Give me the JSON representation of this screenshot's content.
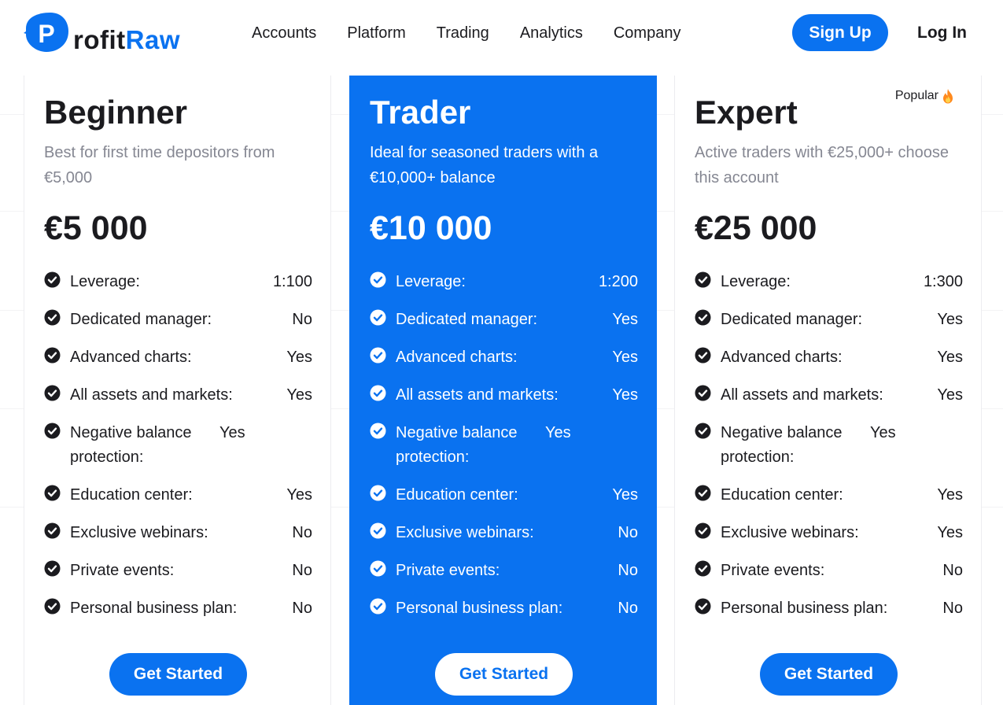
{
  "brand": {
    "logo_letter": "P",
    "name_dark": "rofit",
    "name_blue": "Raw",
    "accent": "#0a72f0"
  },
  "nav": {
    "items": [
      "Accounts",
      "Platform",
      "Trading",
      "Analytics",
      "Company"
    ],
    "signup_label": "Sign Up",
    "login_label": "Log In"
  },
  "plans": [
    {
      "name": "Beginner",
      "description": "Best for first time depositors from €5,000",
      "price": "€5 000",
      "badge": "",
      "cta_label": "Get Started",
      "features": [
        {
          "label": "Leverage:",
          "value": "1:100"
        },
        {
          "label": "Dedicated manager:",
          "value": "No"
        },
        {
          "label": "Advanced charts:",
          "value": "Yes"
        },
        {
          "label": "All assets and markets:",
          "value": "Yes"
        },
        {
          "label": "Negative balance protection:",
          "value": "Yes"
        },
        {
          "label": "Education center:",
          "value": "Yes"
        },
        {
          "label": "Exclusive webinars:",
          "value": "No"
        },
        {
          "label": "Private events:",
          "value": "No"
        },
        {
          "label": "Personal business plan:",
          "value": "No"
        }
      ]
    },
    {
      "name": "Trader",
      "description": "Ideal for seasoned traders with a €10,000+ balance",
      "price": "€10 000",
      "badge": "",
      "cta_label": "Get Started",
      "features": [
        {
          "label": "Leverage:",
          "value": "1:200"
        },
        {
          "label": "Dedicated manager:",
          "value": "Yes"
        },
        {
          "label": "Advanced charts:",
          "value": "Yes"
        },
        {
          "label": "All assets and markets:",
          "value": "Yes"
        },
        {
          "label": "Negative balance protection:",
          "value": "Yes"
        },
        {
          "label": "Education center:",
          "value": "Yes"
        },
        {
          "label": "Exclusive webinars:",
          "value": "No"
        },
        {
          "label": "Private events:",
          "value": "No"
        },
        {
          "label": "Personal business plan:",
          "value": "No"
        }
      ]
    },
    {
      "name": "Expert",
      "description": "Active traders with €25,000+ choose this account",
      "price": "€25 000",
      "badge": "Popular",
      "cta_label": "Get Started",
      "features": [
        {
          "label": "Leverage:",
          "value": "1:300"
        },
        {
          "label": "Dedicated manager:",
          "value": "Yes"
        },
        {
          "label": "Advanced charts:",
          "value": "Yes"
        },
        {
          "label": "All assets and markets:",
          "value": "Yes"
        },
        {
          "label": "Negative balance protection:",
          "value": "Yes"
        },
        {
          "label": "Education center:",
          "value": "Yes"
        },
        {
          "label": "Exclusive webinars:",
          "value": "Yes"
        },
        {
          "label": "Private events:",
          "value": "No"
        },
        {
          "label": "Personal business plan:",
          "value": "No"
        }
      ]
    }
  ],
  "icons": {
    "feature": "check-circle-icon",
    "badge": "fire-icon"
  }
}
